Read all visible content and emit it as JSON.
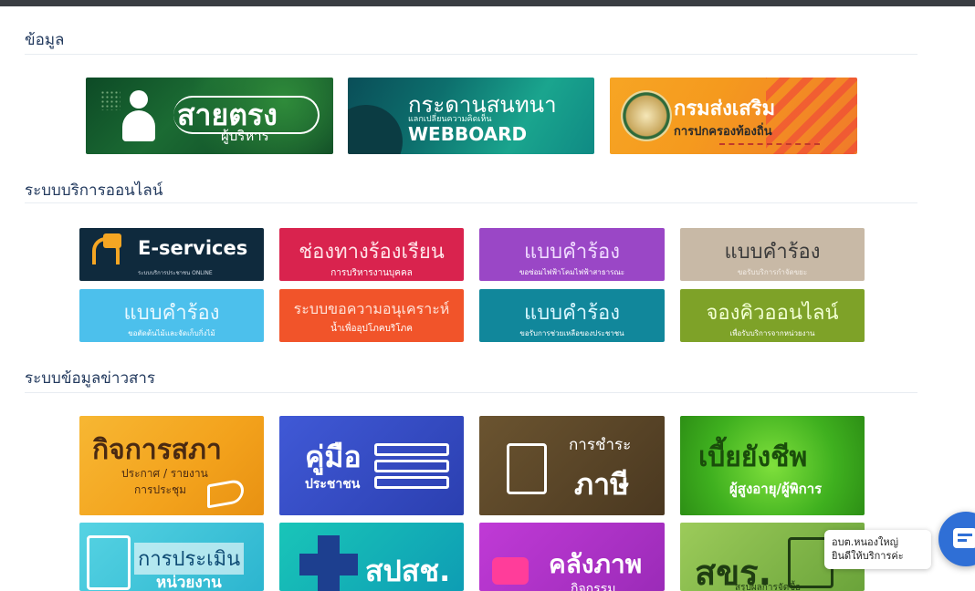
{
  "sections": {
    "info": "ข้อมูล",
    "services": "ระบบบริการออนไลน์",
    "news": "ระบบข้อมูลข่าวสาร"
  },
  "banners": [
    {
      "title": "สายตรง",
      "subtitle": "ผู้บริหาร"
    },
    {
      "title": "กระดานสนทนา",
      "subtitle": "แลกเปลี่ยนความคิดเห็น",
      "tag": "WEBBOARD"
    },
    {
      "title": "กรมส่งเสริม",
      "subtitle": "การปกครองท้องถิ่น"
    }
  ],
  "services": [
    {
      "title": "E-services",
      "subtitle": "ระบบบริการประชาชน ONLINE",
      "color": "#0f2a3d"
    },
    {
      "title": "ช่องทางร้องเรียน",
      "subtitle": "การบริหารงานบุคคล",
      "color": "#d9234e"
    },
    {
      "title": "แบบคำร้อง",
      "subtitle": "ขอซ่อมไฟฟ้าโคมไฟฟ้าสาธารณะ",
      "color": "#9a47c6"
    },
    {
      "title": "แบบคำร้อง",
      "subtitle": "ขอรับบริการกำจัดขยะ",
      "color": "#c8b9a6"
    },
    {
      "title": "แบบคำร้อง",
      "subtitle": "ขอตัดต้นไม้และจัดเก็บกิ่งไม้",
      "color": "#4cc0ec"
    },
    {
      "title": "ระบบขอความอนุเคราะห์",
      "subtitle": "น้ำเพื่ออุปโภคบริโภค",
      "color": "#f1542a"
    },
    {
      "title": "แบบคำร้อง",
      "subtitle": "ขอรับการช่วยเหลือของประชาชน",
      "color": "#11879b"
    },
    {
      "title": "จองคิวออนไลน์",
      "subtitle": "เพื่อรับบริการจากหน่วยงาน",
      "color": "#7ea228"
    }
  ],
  "news": [
    {
      "title": "กิจการสภา",
      "line1": "ประกาศ / รายงาน",
      "line2": "การประชุม"
    },
    {
      "title": "คู่มือ",
      "line1": "ประชาชน"
    },
    {
      "title": "การชำระ",
      "line1": "ภาษี"
    },
    {
      "title": "เบี้ยยังชีพ",
      "line1": "ผู้สูงอายุ/ผู้พิการ"
    },
    {
      "title": "การประเมิน",
      "line1": "หน่วยงาน"
    },
    {
      "title": "สปสช."
    },
    {
      "title": "คลังภาพ",
      "line1": "กิจกรรม"
    },
    {
      "title": "สขร.",
      "line1": "สรุปผลการจัดซื้อ"
    }
  ],
  "chat": {
    "line1": "อบต.หนองใหญ่",
    "line2": "ยินดีให้บริการค่ะ"
  }
}
